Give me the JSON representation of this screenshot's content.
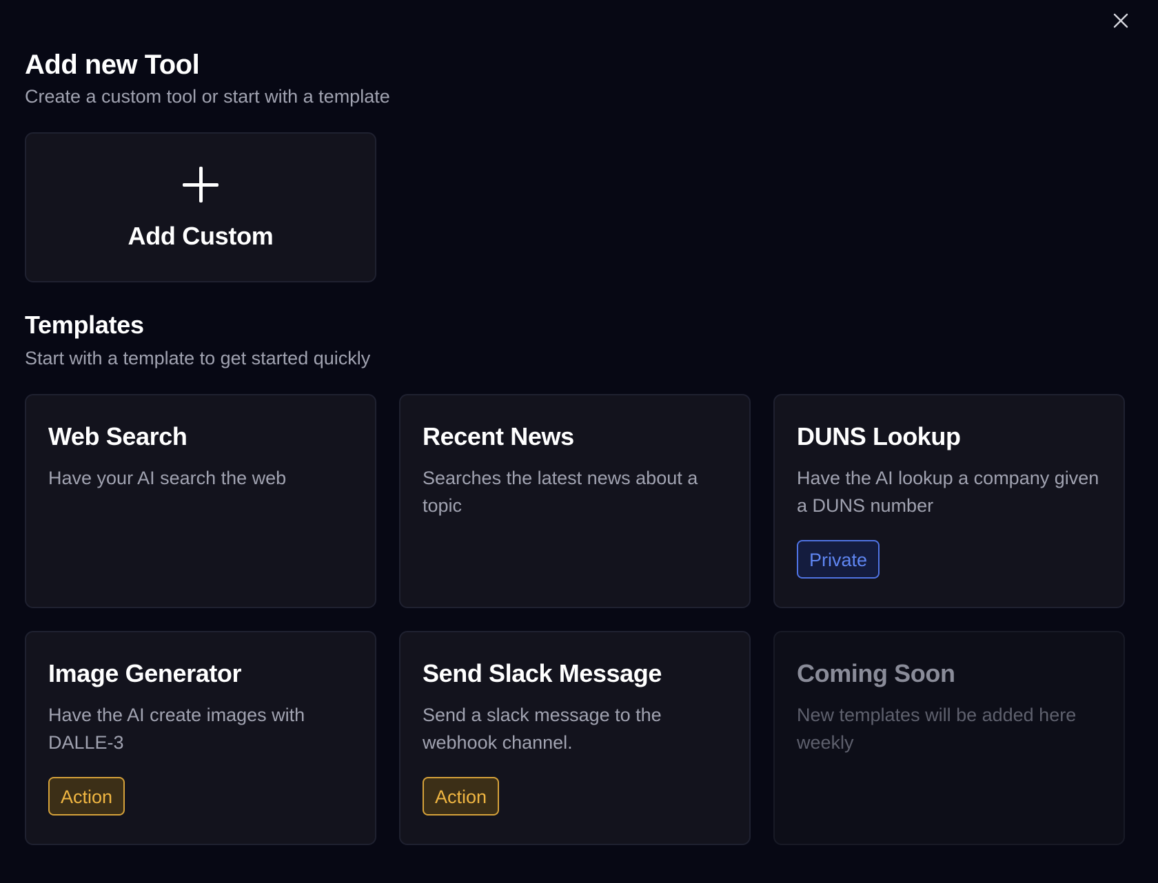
{
  "header": {
    "title": "Add new Tool",
    "subtitle": "Create a custom tool or start with a template",
    "close_icon": "close-icon"
  },
  "custom": {
    "icon": "plus-icon",
    "label": "Add Custom"
  },
  "templates": {
    "title": "Templates",
    "subtitle": "Start with a template to get started quickly",
    "items": [
      {
        "title": "Web Search",
        "description": "Have your AI search the web",
        "badge": ""
      },
      {
        "title": "Recent News",
        "description": "Searches the latest news about a topic",
        "badge": ""
      },
      {
        "title": "DUNS Lookup",
        "description": "Have the AI lookup a company given a DUNS number",
        "badge": "Private"
      },
      {
        "title": "Image Generator",
        "description": "Have the AI create images with DALLE-3",
        "badge": "Action"
      },
      {
        "title": "Send Slack Message",
        "description": "Send a slack message to the webhook channel.",
        "badge": "Action"
      },
      {
        "title": "Coming Soon",
        "description": "New templates will be added here weekly",
        "badge": ""
      }
    ]
  },
  "colors": {
    "background": "#070814",
    "card": "#13131d",
    "private_badge": "#4f73e3",
    "action_badge": "#d6a23a"
  }
}
